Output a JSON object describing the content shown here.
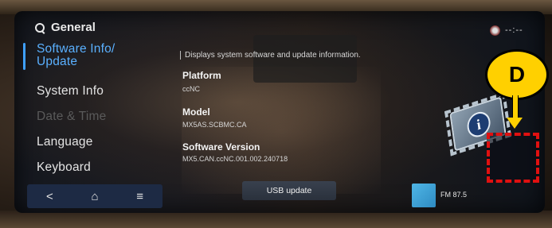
{
  "header": {
    "title": "General"
  },
  "sidebar": {
    "items": [
      {
        "label": "Software Info/",
        "label2": "Update",
        "state": "active"
      },
      {
        "label": "System Info",
        "state": "normal"
      },
      {
        "label": "Date & Time",
        "state": "disabled"
      },
      {
        "label": "Language",
        "state": "normal"
      },
      {
        "label": "Keyboard",
        "state": "normal"
      }
    ]
  },
  "navbar": {
    "back": "<",
    "home": "⌂",
    "menu": "≡"
  },
  "content": {
    "description": "Displays system software and update information.",
    "platform_label": "Platform",
    "platform_value": "ccNC",
    "model_label": "Model",
    "model_value": "MX5AS.SCBMC.CA",
    "version_label": "Software Version",
    "version_value": "MX5.CAN.ccNC.001.002.240718"
  },
  "usb_update": {
    "label": "USB update"
  },
  "media": {
    "label": "FM 87.5"
  },
  "status": {
    "clock": "--:--"
  },
  "annotation": {
    "letter": "D",
    "color": "#ffd000",
    "box_color": "#e01010"
  },
  "colors": {
    "accent": "#3fa0ff",
    "navbar": "#1d2a44"
  }
}
